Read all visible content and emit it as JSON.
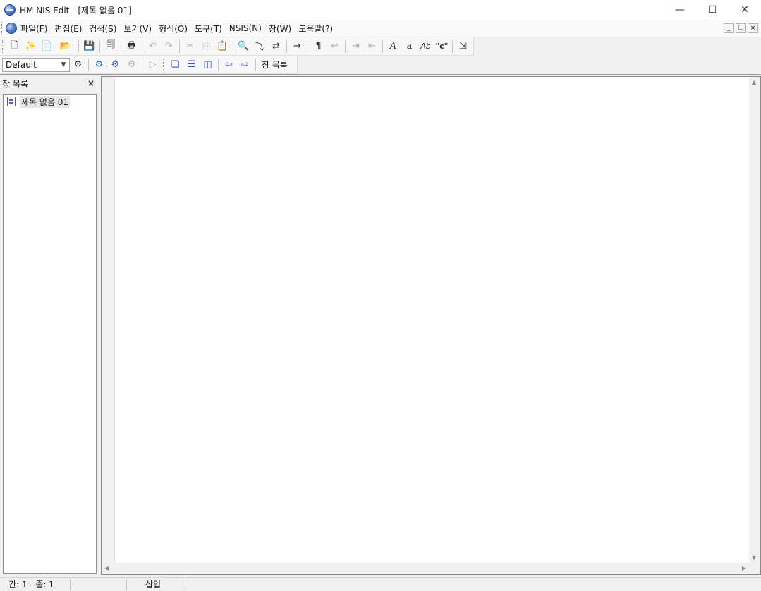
{
  "window": {
    "title": "HM NIS Edit - [제목 없음 01]",
    "minimize_glyph": "—",
    "maximize_glyph": "☐",
    "close_glyph": "✕"
  },
  "menu": {
    "items": [
      "파일(F)",
      "편집(E)",
      "검색(S)",
      "보기(V)",
      "형식(O)",
      "도구(T)",
      "NSIS(N)",
      "창(W)",
      "도움말(?)"
    ],
    "mdi_minimize": "_",
    "mdi_restore": "❐",
    "mdi_close": "×"
  },
  "toolbar_main": {
    "icons": {
      "new": "🗋",
      "wizard": "✨",
      "template": "📄",
      "open": "📂",
      "save": "💾",
      "save_all": "🗐",
      "print": "🖶",
      "undo": "↶",
      "redo": "↷",
      "cut": "✂",
      "copy": "⎘",
      "paste": "📋",
      "find": "🔍",
      "find_next": "⤵",
      "replace": "⇄",
      "goto": "→",
      "show_whitespace": "¶",
      "word_wrap": "↩",
      "indent": "⇥",
      "unindent": "⇤",
      "italic_font": "A",
      "lowercase": "a",
      "strike_case": "Ab",
      "quote": "\"c\"",
      "insert_file": "⇲"
    }
  },
  "toolbar_nsis": {
    "config_value": "Default",
    "switch_label": "창 목록",
    "icons": {
      "settings": "⚙",
      "compile": "⚙",
      "compile_run": "⚙",
      "compile_stop": "⚙",
      "run": "▷",
      "cascade": "❏",
      "tile_horizontal": "☰",
      "tile_vertical": "◫",
      "previous": "⇦",
      "next": "⇨"
    }
  },
  "sidebar": {
    "title": "창 목록",
    "close_glyph": "×",
    "items": [
      "제목 없음 01"
    ]
  },
  "editor": {
    "scroll_up": "▲",
    "scroll_down": "▼",
    "scroll_left": "◀",
    "scroll_right": "▶"
  },
  "status": {
    "position": "칸: 1 - 줄: 1",
    "mode": "삽입"
  }
}
